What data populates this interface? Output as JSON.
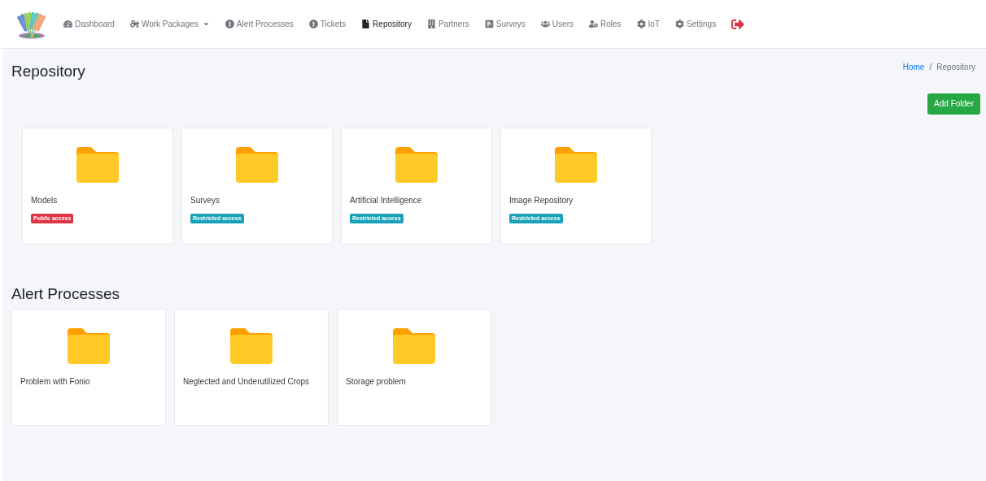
{
  "nav": {
    "items": [
      {
        "label": "Dashboard",
        "selected": false,
        "dropdown": false
      },
      {
        "label": "Work Packages",
        "selected": false,
        "dropdown": true
      },
      {
        "label": "Alert Processes",
        "selected": false,
        "dropdown": false
      },
      {
        "label": "Tickets",
        "selected": false,
        "dropdown": false
      },
      {
        "label": "Repository",
        "selected": true,
        "dropdown": false
      },
      {
        "label": "Partners",
        "selected": false,
        "dropdown": false
      },
      {
        "label": "Surveys",
        "selected": false,
        "dropdown": false
      },
      {
        "label": "Users",
        "selected": false,
        "dropdown": false
      },
      {
        "label": "Roles",
        "selected": false,
        "dropdown": false
      },
      {
        "label": "IoT",
        "selected": false,
        "dropdown": false
      },
      {
        "label": "Settings",
        "selected": false,
        "dropdown": false
      }
    ]
  },
  "page_title": "Repository",
  "breadcrumb_separator": "/",
  "breadcrumb": [
    {
      "label": "Home",
      "kind": "link"
    },
    {
      "label": "Repository",
      "kind": "current"
    }
  ],
  "add_button": "Add Folder",
  "folders": [
    {
      "name": "Models",
      "access": {
        "label": "Public access",
        "kind": "public"
      }
    },
    {
      "name": "Surveys",
      "access": {
        "label": "Restricted access",
        "kind": "restricted"
      }
    },
    {
      "name": "Artificial Intelligence",
      "access": {
        "label": "Restricted access",
        "kind": "restricted"
      }
    },
    {
      "name": "Image Repository",
      "access": {
        "label": "Restricted access",
        "kind": "restricted"
      }
    }
  ],
  "alert_section": {
    "title": "Alert Processes",
    "items": [
      {
        "name": "Problem with Fonio"
      },
      {
        "name": "Neglected and Underutilized Crops"
      },
      {
        "name": "Storage problem"
      }
    ]
  }
}
